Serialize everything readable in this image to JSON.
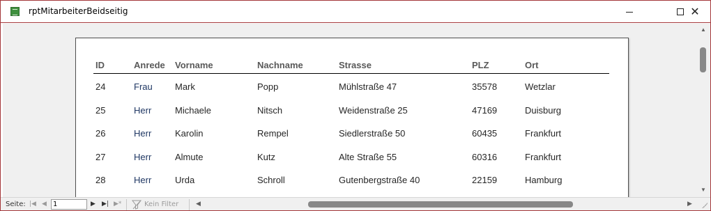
{
  "window": {
    "title": "rptMitarbeiterBeidseitig",
    "buttons": {
      "minimize": "minimize",
      "maximize": "maximize",
      "close": "✕"
    }
  },
  "report": {
    "columns": {
      "id": "ID",
      "anrede": "Anrede",
      "vorname": "Vorname",
      "nachname": "Nachname",
      "strasse": "Strasse",
      "plz": "PLZ",
      "ort": "Ort"
    },
    "rows": [
      {
        "id": "24",
        "anrede": "Frau",
        "vorname": "Mark",
        "nachname": "Popp",
        "strasse": "Mühlstraße 47",
        "plz": "35578",
        "ort": "Wetzlar"
      },
      {
        "id": "25",
        "anrede": "Herr",
        "vorname": "Michaele",
        "nachname": "Nitsch",
        "strasse": "Weidenstraße 25",
        "plz": "47169",
        "ort": "Duisburg"
      },
      {
        "id": "26",
        "anrede": "Herr",
        "vorname": "Karolin",
        "nachname": "Rempel",
        "strasse": "Siedlerstraße 50",
        "plz": "60435",
        "ort": "Frankfurt"
      },
      {
        "id": "27",
        "anrede": "Herr",
        "vorname": "Almute",
        "nachname": "Kutz",
        "strasse": "Alte Straße 55",
        "plz": "60316",
        "ort": "Frankfurt"
      },
      {
        "id": "28",
        "anrede": "Herr",
        "vorname": "Urda",
        "nachname": "Schroll",
        "strasse": "Gutenbergstraße 40",
        "plz": "22159",
        "ort": "Hamburg"
      }
    ]
  },
  "statusbar": {
    "page_label": "Seite:",
    "page_value": "1",
    "filter_label": "Kein Filter"
  },
  "icons": {
    "app": "report-icon",
    "filter": "filter-icon"
  }
}
